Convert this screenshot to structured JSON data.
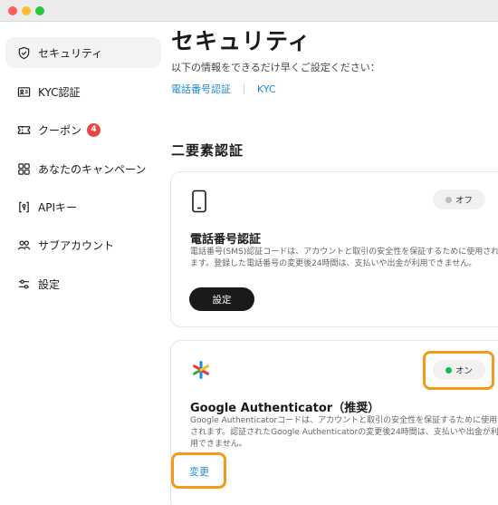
{
  "sidebar": {
    "items": [
      {
        "label": "セキュリティ",
        "icon": "shield-icon"
      },
      {
        "label": "KYC認証",
        "icon": "id-card-icon"
      },
      {
        "label": "クーポン",
        "icon": "ticket-icon",
        "badge": "4"
      },
      {
        "label": "あなたのキャンペーン",
        "icon": "grid-icon"
      },
      {
        "label": "APIキー",
        "icon": "api-key-icon"
      },
      {
        "label": "サブアカウント",
        "icon": "users-icon"
      },
      {
        "label": "設定",
        "icon": "sliders-icon"
      }
    ]
  },
  "main": {
    "title": "セキュリティ",
    "subtitle": "以下の情報をできるだけ早くご設定ください：",
    "links": [
      "電話番号認証",
      "KYC"
    ],
    "section_title": "二要素認証",
    "cards": [
      {
        "icon": "phone-icon",
        "title": "電話番号認証",
        "description": "電話番号(SMS)認証コードは、アカウントと取引の安全性を保証するために使用されます。登録した電話番号の変更後24時間は、支払いや出金が利用できません。",
        "status": "オフ",
        "status_color": "#bdbdbd",
        "action": "設定"
      },
      {
        "icon": "google-authenticator-icon",
        "title": "Google Authenticator（推奨）",
        "description": "Google Authenticatorコードは、アカウントと取引の安全性を保証するために使用されます。認証されたGoogle Authenticatorの変更後24時間は、支払いや出金が利用できません。",
        "status": "オン",
        "status_color": "#1db85c",
        "action": "変更"
      }
    ]
  },
  "colors": {
    "accent": "#1f8bd8",
    "highlight": "#f39a1d",
    "badge": "#e84646"
  }
}
